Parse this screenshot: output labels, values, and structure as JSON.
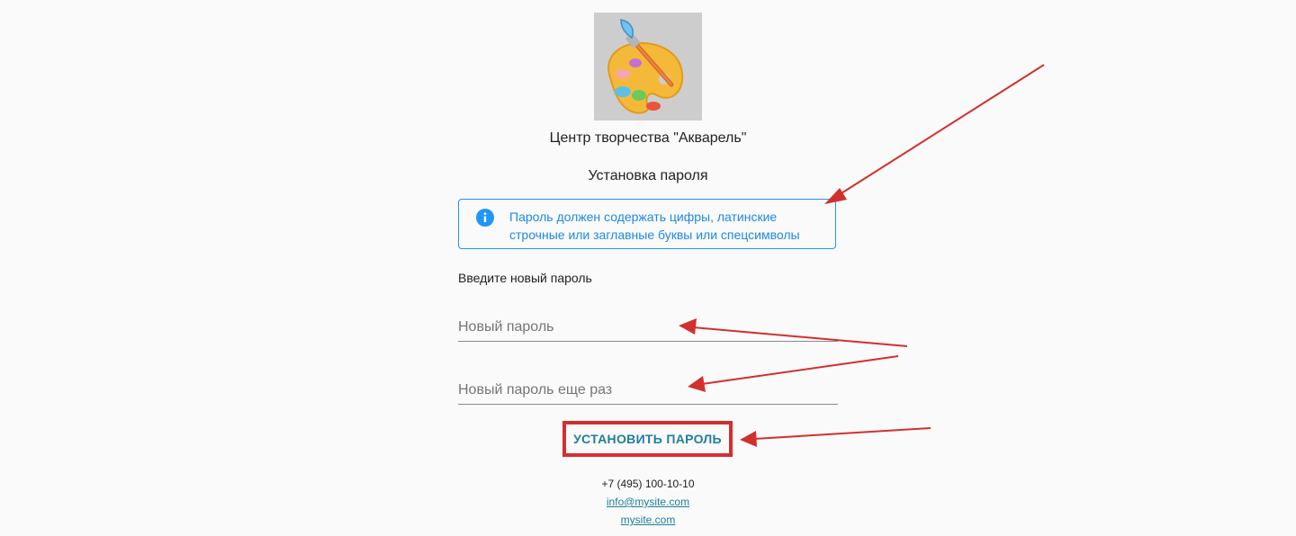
{
  "org": {
    "name": "Центр творчества \"Акварель\"",
    "logo_icon": "palette-brush-icon"
  },
  "page": {
    "title": "Установка пароля"
  },
  "info": {
    "icon": "info-icon",
    "line1": "Пароль должен содержать цифры, латинские",
    "line2": "строчные или заглавные буквы или спецсимволы",
    "color": "#2196f3"
  },
  "form": {
    "caption": "Введите новый пароль",
    "password": {
      "placeholder": "Новый пароль",
      "value": ""
    },
    "password_repeat": {
      "placeholder": "Новый пароль еще раз",
      "value": ""
    },
    "submit_label": "УСТАНОВИТЬ ПАРОЛЬ"
  },
  "footer": {
    "phone": "+7 (495) 100-10-10",
    "email": "info@mysite.com",
    "site": "mysite.com"
  },
  "annotations": {
    "arrow_color": "#d32f2f"
  }
}
